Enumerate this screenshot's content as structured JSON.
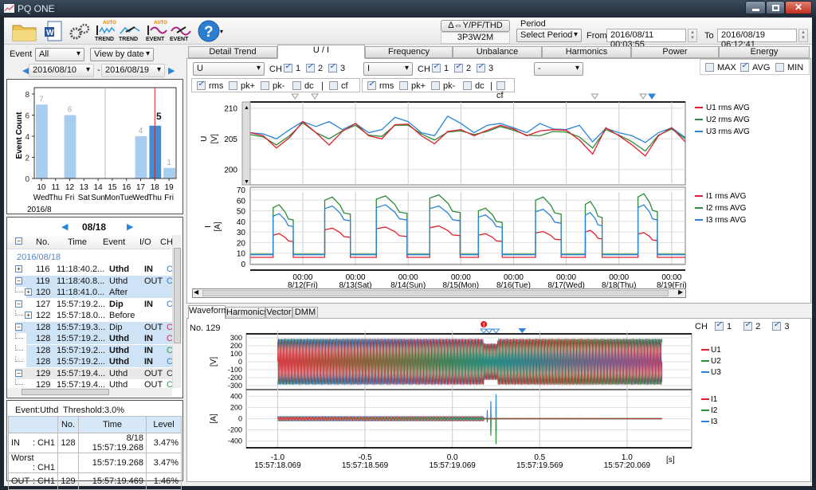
{
  "window": {
    "title": "PQ ONE"
  },
  "toolbar": {
    "icons": [
      "open-folder-icon",
      "word-report-icon",
      "settings-gears-icon",
      "auto-trend-icon",
      "trend-icon",
      "auto-event-icon",
      "event-icon",
      "help-icon"
    ],
    "trend_label": "TREND",
    "event_label": "EVENT",
    "auto_label": "AUTO"
  },
  "header": {
    "connection_button": "Δ⇔Y/PF/THD",
    "wiring": "3P3W2M",
    "period_label": "Period",
    "period_select": "Select Period",
    "from_label": "From",
    "from_value": "2016/08/11 00:03:55",
    "to_label": "To",
    "to_value": "2016/08/19 06:12:41"
  },
  "left": {
    "event_label": "Event",
    "event_filter": "All",
    "view_mode": "View by date",
    "date_from": "2016/08/10",
    "date_sep": "-",
    "date_to": "2016/08/19",
    "list_date": "08/18",
    "list_columns": [
      "No.",
      "Time",
      "Event",
      "I/O",
      "CH"
    ],
    "group_date": "2016/08/18",
    "rows": [
      {
        "exp": "+",
        "no": "116",
        "time": "11:18:40.2...",
        "event": "Uthd",
        "bold": true,
        "io": "IN",
        "ch": "CH",
        "chc": "#3a7fc8",
        "bg": "",
        "indent": false
      },
      {
        "exp": "-",
        "no": "119",
        "time": "11:18:40.8...",
        "event": "Uthd",
        "bold": false,
        "io": "OUT",
        "ch": "CH",
        "chc": "#3a7fc8",
        "bg": "hl",
        "indent": false
      },
      {
        "exp": "+",
        "no": "120",
        "time": "11:18:41.0...",
        "event": "After",
        "bold": false,
        "io": "",
        "ch": "",
        "chc": "",
        "bg": "hl",
        "indent": true
      },
      {
        "exp": "-",
        "no": "127",
        "time": "15:57:19.2...",
        "event": "Dip",
        "bold": true,
        "io": "IN",
        "ch": "CH",
        "chc": "#3a7fc8",
        "bg": "",
        "indent": false
      },
      {
        "exp": "+",
        "no": "122",
        "time": "15:57:18.0...",
        "event": "Before",
        "bold": false,
        "io": "",
        "ch": "",
        "chc": "",
        "bg": "",
        "indent": true
      },
      {
        "exp": "-",
        "no": "128",
        "time": "15:57:19.3...",
        "event": "Dip",
        "bold": false,
        "io": "OUT",
        "ch": "CH",
        "chc": "#d0305a",
        "bg": "hl",
        "indent": false
      },
      {
        "exp": "",
        "no": "128",
        "time": "15:57:19.2...",
        "event": "Uthd",
        "bold": true,
        "io": "IN",
        "ch": "CH",
        "chc": "#d0305a",
        "bg": "hl",
        "indent": true
      },
      {
        "exp": "",
        "no": "128",
        "time": "15:57:19.2...",
        "event": "Uthd",
        "bold": true,
        "io": "IN",
        "ch": "CH",
        "chc": "#3a9a50",
        "bg": "hl",
        "indent": true
      },
      {
        "exp": "",
        "no": "128",
        "time": "15:57:19.2...",
        "event": "Uthd",
        "bold": true,
        "io": "IN",
        "ch": "CH",
        "chc": "#3a7fc8",
        "bg": "hl",
        "indent": true
      },
      {
        "exp": "-",
        "no": "129",
        "time": "15:57:19.4...",
        "event": "Uthd",
        "bold": false,
        "io": "OUT",
        "ch": "CH",
        "chc": "#333",
        "bg": "gr",
        "indent": false
      },
      {
        "exp": "",
        "no": "129",
        "time": "15:57:19.4...",
        "event": "Uthd",
        "bold": false,
        "io": "OUT",
        "ch": "CH",
        "chc": "#3a9a50",
        "bg": "",
        "indent": true
      }
    ],
    "summary": {
      "event": "Event:Uthd",
      "threshold": "Threshold:3.0%",
      "columns": [
        "",
        "No.",
        "Time",
        "Level"
      ],
      "rows": [
        {
          "label": "IN",
          "ch": ": CH1",
          "no": "128",
          "time": "8/18 15:57:19.268",
          "level": "3.47%"
        },
        {
          "label": "Worst",
          "ch": ": CH1",
          "no": "",
          "time": "15:57:19.268",
          "level": "3.47%"
        },
        {
          "label": "OUT",
          "ch": ": CH1",
          "no": "129",
          "time": "15:57:19.469",
          "level": "1.46%"
        }
      ]
    }
  },
  "tabs": [
    "Detail Trend",
    "U / I",
    "Frequency",
    "Unbalance",
    "Harmonics",
    "Power",
    "Energy"
  ],
  "active_tab": "U / I",
  "controls": {
    "u_select": "U",
    "i_select": "I",
    "other_select": "-",
    "ch_label": "CH",
    "ch": [
      "1",
      "2",
      "3"
    ],
    "types": [
      "rms",
      "pk+",
      "pk-",
      "dc",
      "cf"
    ],
    "sep": "|",
    "stats": [
      {
        "label": "MAX",
        "checked": false
      },
      {
        "label": "AVG",
        "checked": true
      },
      {
        "label": "MIN",
        "checked": false
      }
    ]
  },
  "bottom": {
    "tabs": [
      "Waveform",
      "Harmonics",
      "Vector",
      "DMM"
    ],
    "active": "Waveform",
    "event_no": "No. 129",
    "ch_label": "CH",
    "ch": [
      "1",
      "2",
      "3"
    ],
    "unit_s": "[s]"
  },
  "colors": {
    "ch1": "#e0202e",
    "ch2": "#2e8b3a",
    "ch3": "#2a84d8",
    "bar": "#a9cdef",
    "bar_selected": "#3d8fd8",
    "selected_line": "#e02020"
  },
  "chart_data": [
    {
      "type": "bar",
      "ylabel": "Event Count",
      "ylim": [
        0,
        8
      ],
      "yticks": [
        0,
        2,
        4,
        6,
        8
      ],
      "xlabel": "2016/8",
      "categories": [
        [
          "10",
          "Wed"
        ],
        [
          "11",
          "Thu"
        ],
        [
          "12",
          "Fri"
        ],
        [
          "13",
          "Sat"
        ],
        [
          "14",
          "Sun"
        ],
        [
          "15",
          "Mon"
        ],
        [
          "16",
          "Tue"
        ],
        [
          "17",
          "Wed"
        ],
        [
          "18",
          "Thu"
        ],
        [
          "19",
          "Fri"
        ]
      ],
      "values": [
        7,
        0,
        6,
        0,
        0,
        0,
        0,
        4,
        5,
        1
      ],
      "selected": "18"
    },
    {
      "type": "line",
      "ylabel": "U",
      "yunit": "[V]",
      "ylim": [
        197.5,
        211
      ],
      "yticks": [
        200,
        205,
        210
      ],
      "xlim": [
        "08/11 00:04",
        "08/19 06:13"
      ],
      "xticks": [
        [
          "00:00",
          "8/12(Fri)"
        ],
        [
          "00:00",
          "8/13(Sat)"
        ],
        [
          "00:00",
          "8/14(Sun)"
        ],
        [
          "00:00",
          "8/15(Mon)"
        ],
        [
          "00:00",
          "8/16(Tue)"
        ],
        [
          "00:00",
          "8/17(Wed)"
        ],
        [
          "00:00",
          "8/18(Thu)"
        ],
        [
          "00:00",
          "8/19(Fri)"
        ]
      ],
      "x": [
        "08/11 00:04",
        "08/11 06:00",
        "08/11 12:00",
        "08/11 18:00",
        "08/12 00:00",
        "08/12 06:00",
        "08/12 12:00",
        "08/12 18:00",
        "08/13 00:00",
        "08/13 06:00",
        "08/13 12:00",
        "08/13 18:00",
        "08/14 00:00",
        "08/14 06:00",
        "08/14 12:00",
        "08/14 18:00",
        "08/15 00:00",
        "08/15 06:00",
        "08/15 12:00",
        "08/15 18:00",
        "08/16 00:00",
        "08/16 06:00",
        "08/16 12:00",
        "08/16 18:00",
        "08/17 00:00",
        "08/17 06:00",
        "08/17 12:00",
        "08/17 18:00",
        "08/18 00:00",
        "08/18 06:00",
        "08/18 12:00",
        "08/18 18:00",
        "08/19 00:00",
        "08/19 06:13"
      ],
      "series": [
        {
          "name": "U1 rms AVG",
          "values": [
            206,
            205.5,
            203.5,
            205.2,
            207.8,
            206,
            204,
            206.2,
            207.5,
            205.5,
            205,
            207.3,
            207.4,
            205.5,
            204.2,
            206.2,
            206.5,
            205.5,
            206.4,
            207.2,
            206.6,
            205.5,
            206.3,
            206.5,
            206.4,
            204.8,
            202.5,
            206.8,
            205.5,
            204,
            202.2,
            205.5,
            206.8,
            204.5
          ]
        },
        {
          "name": "U2 rms AVG",
          "values": [
            205.7,
            205.3,
            204,
            205.5,
            207.6,
            206,
            205,
            206.3,
            207.2,
            205.6,
            205.4,
            207.2,
            207.2,
            205.8,
            204.8,
            206.1,
            206.3,
            205.7,
            206.2,
            207,
            206.4,
            205.6,
            205.5,
            206.2,
            206.1,
            205.3,
            203.5,
            206.5,
            205.6,
            204.5,
            203,
            205.6,
            206.6,
            205
          ]
        },
        {
          "name": "U3 rms AVG",
          "values": [
            206,
            205.8,
            205,
            206.5,
            207.8,
            207,
            207.8,
            206.5,
            207.5,
            206,
            206.5,
            208.5,
            207.8,
            206,
            205.5,
            208.7,
            207.5,
            206,
            207.2,
            207.5,
            206.8,
            206,
            207.5,
            206.6,
            206.5,
            207.2,
            204.5,
            206.7,
            206,
            205.5,
            204.4,
            206,
            206.8,
            205.2
          ]
        }
      ]
    },
    {
      "type": "line",
      "ylabel": "I",
      "yunit": "[A]",
      "ylim": [
        0,
        70
      ],
      "yticks": [
        0,
        10,
        20,
        30,
        40,
        50,
        60,
        70
      ],
      "xlim": [
        "08/11 00:04",
        "08/19 06:13"
      ],
      "night_level": {
        "I1": 6,
        "I2": 9,
        "I3": 8.5
      },
      "day_blocks": [
        {
          "start": "08/11 10:30",
          "end": "08/11 19:40",
          "I1": 27,
          "I2": 53,
          "I3": 45
        },
        {
          "start": "08/12 10:00",
          "end": "08/12 21:40",
          "I1": 32,
          "I2": 60,
          "I3": 52
        },
        {
          "start": "08/13 09:30",
          "end": "08/13 23:30",
          "I1": 33,
          "I2": 61,
          "I3": 53
        },
        {
          "start": "08/14 09:50",
          "end": "08/14 23:40",
          "I1": 34,
          "I2": 62,
          "I3": 52
        },
        {
          "start": "08/15 08:00",
          "end": "08/15 18:50",
          "I1": 27,
          "I2": 50,
          "I3": 44
        },
        {
          "start": "08/16 10:00",
          "end": "08/16 21:40",
          "I1": 29,
          "I2": 60,
          "I3": 49
        },
        {
          "start": "08/17 08:40",
          "end": "08/17 16:20",
          "I1": 30,
          "I2": 56,
          "I3": 46
        },
        {
          "start": "08/18 08:40",
          "end": "08/18 17:30",
          "I1": 28,
          "I2": 63,
          "I3": 53
        }
      ],
      "series": [
        {
          "name": "I1 rms AVG"
        },
        {
          "name": "I2 rms AVG"
        },
        {
          "name": "I3 rms AVG"
        }
      ]
    },
    {
      "type": "line",
      "ylabel": "[V]",
      "ylim": [
        -350,
        350
      ],
      "yticks": [
        300,
        200,
        100,
        0,
        -100,
        -200,
        -300
      ],
      "xlim": [
        -1.18,
        1.37
      ],
      "xticks": [
        [
          "-1.0",
          "15:57:18.069"
        ],
        [
          "-0.5",
          "15:57:18.569"
        ],
        [
          "0.0",
          "15:57:19.069"
        ],
        [
          "0.5",
          "15:57:19.569"
        ],
        [
          "1.0",
          "15:57:20.069"
        ]
      ],
      "signal_range": [
        -1.0,
        1.2
      ],
      "peak": 290,
      "dip_range": [
        0.18,
        0.26
      ],
      "dip_peak": 230,
      "series": [
        {
          "name": "U1"
        },
        {
          "name": "U2"
        },
        {
          "name": "U3"
        }
      ]
    },
    {
      "type": "line",
      "ylabel": "[A]",
      "ylim": [
        -520,
        520
      ],
      "yticks": [
        400,
        200,
        0,
        -200,
        -400
      ],
      "xlim": [
        -1.18,
        1.37
      ],
      "signal_range": [
        -1.0,
        1.2
      ],
      "peak": 40,
      "after_peak": 8,
      "spikes": [
        {
          "t": 0.2,
          "I3": 150,
          "I2": -60
        },
        {
          "t": 0.22,
          "I3": 310,
          "I2": -300
        },
        {
          "t": 0.25,
          "I3": 430,
          "I2": -450
        }
      ],
      "series": [
        {
          "name": "I1"
        },
        {
          "name": "I2"
        },
        {
          "name": "I3"
        }
      ]
    }
  ]
}
